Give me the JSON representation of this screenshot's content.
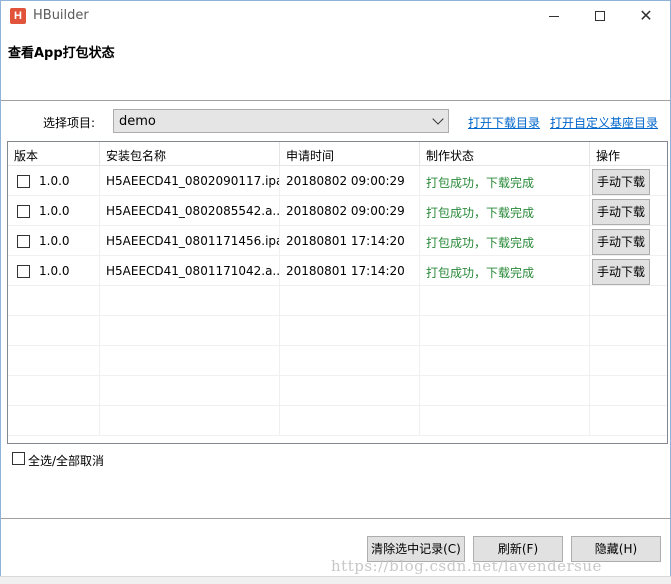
{
  "window": {
    "app_logo": "H",
    "title": "HBuilder",
    "controls": {
      "minimize": "—",
      "maximize": "☐",
      "close": "✕"
    }
  },
  "header": {
    "title": "查看App打包状态"
  },
  "project": {
    "label": "选择项目:",
    "selected": "demo",
    "open_download_dir": "打开下载目录",
    "open_custom_base_dir": "打开自定义基座目录"
  },
  "table": {
    "columns": [
      "版本",
      "安装包名称",
      "申请时间",
      "制作状态",
      "操作"
    ],
    "rows": [
      {
        "version": "1.0.0",
        "package": "H5AEECD41_0802090117.ipa",
        "time": "20180802 09:00:29",
        "status": "打包成功，下载完成",
        "action": "手动下载"
      },
      {
        "version": "1.0.0",
        "package": "H5AEECD41_0802085542.a...",
        "time": "20180802 09:00:29",
        "status": "打包成功，下载完成",
        "action": "手动下载"
      },
      {
        "version": "1.0.0",
        "package": "H5AEECD41_0801171456.ipa",
        "time": "20180801 17:14:20",
        "status": "打包成功，下载完成",
        "action": "手动下载"
      },
      {
        "version": "1.0.0",
        "package": "H5AEECD41_0801171042.a...",
        "time": "20180801 17:14:20",
        "status": "打包成功，下载完成",
        "action": "手动下载"
      }
    ],
    "status_color": "#2a8a3a"
  },
  "select_all": {
    "label": "全选/全部取消"
  },
  "buttons": {
    "clear": "清除选中记录(C)",
    "refresh": "刷新(F)",
    "hide": "隐藏(H)"
  },
  "watermark": "https://blog.csdn.net/lavendersue",
  "colors": {
    "link": "#0066cc",
    "logo": "#e2533b",
    "border": "#8fb2d9"
  }
}
